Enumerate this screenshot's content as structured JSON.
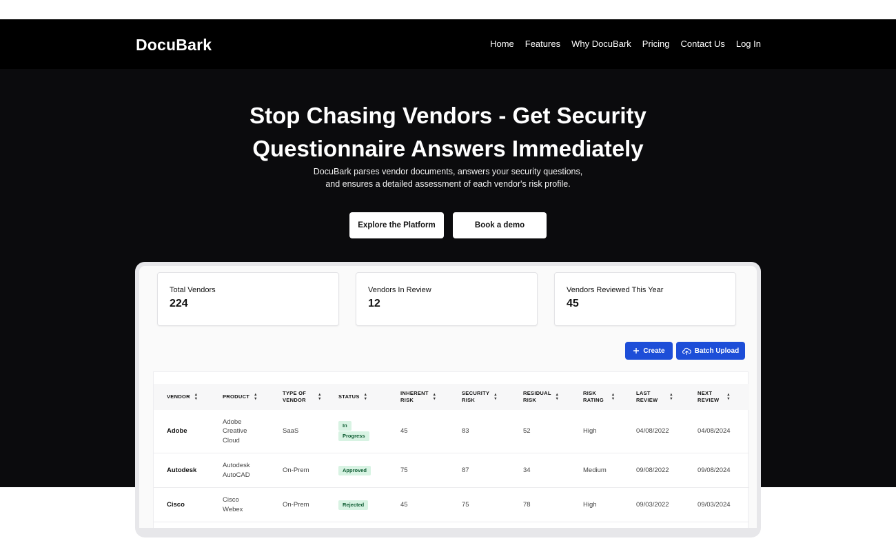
{
  "nav": {
    "logo": "DocuBark",
    "links": [
      "Home",
      "Features",
      "Why DocuBark",
      "Pricing",
      "Contact Us",
      "Log In"
    ]
  },
  "hero": {
    "title_line1": "Stop Chasing Vendors - Get Security",
    "title_line2": "Questionnaire Answers Immediately",
    "subtitle_line1": "DocuBark parses vendor documents, answers your security questions,",
    "subtitle_line2": "and ensures a detailed assessment of each vendor's risk profile.",
    "primary_cta": "Explore the Platform",
    "secondary_cta": "Book a demo"
  },
  "dashboard": {
    "stats": [
      {
        "label": "Total Vendors",
        "value": "224"
      },
      {
        "label": "Vendors In Review",
        "value": "12"
      },
      {
        "label": "Vendors Reviewed This Year",
        "value": "45"
      }
    ],
    "create_label": "Create",
    "batch_upload_label": "Batch Upload",
    "table": {
      "columns": [
        [
          "VENDOR"
        ],
        [
          "PRODUCT"
        ],
        [
          "TYPE OF",
          "VENDOR"
        ],
        [
          "STATUS"
        ],
        [
          "INHERENT",
          "RISK"
        ],
        [
          "SECURITY",
          "RISK"
        ],
        [
          "RESIDUAL",
          "RISK"
        ],
        [
          "RISK",
          "RATING"
        ],
        [
          "LAST",
          "REVIEW"
        ],
        [
          "NEXT",
          "REVIEW"
        ]
      ],
      "rows": [
        {
          "vendor": "Adobe",
          "product": [
            "Adobe",
            "Creative",
            "Cloud"
          ],
          "type": "SaaS",
          "status": [
            "In",
            "Progress"
          ],
          "inherent": "45",
          "security": "83",
          "residual": "52",
          "rating": "High",
          "last": "04/08/2022",
          "next": "04/08/2024"
        },
        {
          "vendor": "Autodesk",
          "product": [
            "Autodesk",
            "AutoCAD"
          ],
          "type": "On-Prem",
          "status": [
            "Approved"
          ],
          "inherent": "75",
          "security": "87",
          "residual": "34",
          "rating": "Medium",
          "last": "09/08/2022",
          "next": "09/08/2024"
        },
        {
          "vendor": "Cisco",
          "product": [
            "Cisco",
            "Webex"
          ],
          "type": "On-Prem",
          "status": [
            "Rejected"
          ],
          "inherent": "45",
          "security": "75",
          "residual": "78",
          "rating": "High",
          "last": "09/03/2022",
          "next": "09/03/2024"
        }
      ]
    }
  },
  "colors": {
    "hero_bg": "#0b0b0d",
    "nav_bg": "#000000",
    "accent_blue": "#1d4ed8",
    "badge_bg": "#d8f3e3",
    "badge_text": "#0d5b31"
  },
  "icons": {
    "create": "plus-icon",
    "batch_upload": "cloud-upload-icon",
    "sort": "sort-icon"
  }
}
